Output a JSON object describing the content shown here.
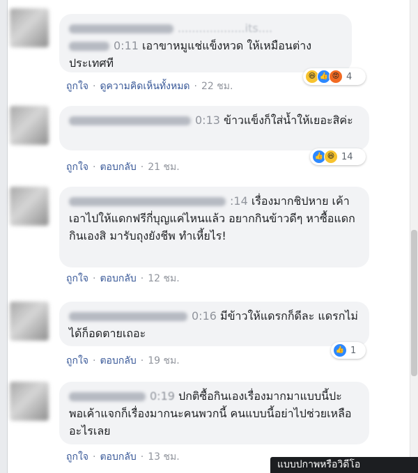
{
  "comments": [
    {
      "name_partial": "...................its....",
      "timestamp": "0:11",
      "text": "เอาขาหมูแช่แข็งหวด ให้เหมือนต่างประเทศที",
      "like_label": "ถูกใจ",
      "second_action": "ดูความคิดเห็นทั้งหมด",
      "time": "22 ชม.",
      "reaction_count": "4",
      "reactions": [
        "haha",
        "like",
        "angry"
      ]
    },
    {
      "timestamp": "0:13",
      "text": "ข้าวแข็งก็ใส่น้ำให้เยอะสิค่ะ",
      "like_label": "ถูกใจ",
      "second_action": "ตอบกลับ",
      "time": "21 ชม.",
      "reaction_count": "14",
      "reactions": [
        "like",
        "haha"
      ]
    },
    {
      "timestamp": ":14",
      "text": "เรื่องมากชิปหาย เค้าเอาไปให้แดกฟรีกี่บุญแค่ไหนแล้ว อยากกินข้าวดีๆ หาซื้อแดกกินเองสิ มารับถุงยังชีพ ทำเหี้ยไร!",
      "like_label": "ถูกใจ",
      "second_action": "ตอบกลับ",
      "time": "12 ชม."
    },
    {
      "timestamp": "0:16",
      "text": "มีข้าวให้แดรกก็ดีละ แดรกไม่ได้ก็อดตายเถอะ",
      "like_label": "ถูกใจ",
      "second_action": "ตอบกลับ",
      "time": "19 ชม.",
      "reaction_count": "1",
      "reactions": [
        "like"
      ]
    },
    {
      "timestamp": "0:19",
      "text": "ปกติซื้อกินเองเรื่องมากมาแบบนี้ปะ พอเค้าแจกก็เรื่องมากนะคนพวกนี้ คนแบบนี้อย่าไปช่วยเหลืออะไรเลย",
      "like_label": "ถูกใจ",
      "second_action": "ตอบกลับ",
      "time": "13 ชม."
    }
  ],
  "tooltip": "แบบปกาพหรือวิดีโอ",
  "colors": {
    "link": "#385898",
    "bubble": "#f2f3f5",
    "meta": "#90949c"
  }
}
